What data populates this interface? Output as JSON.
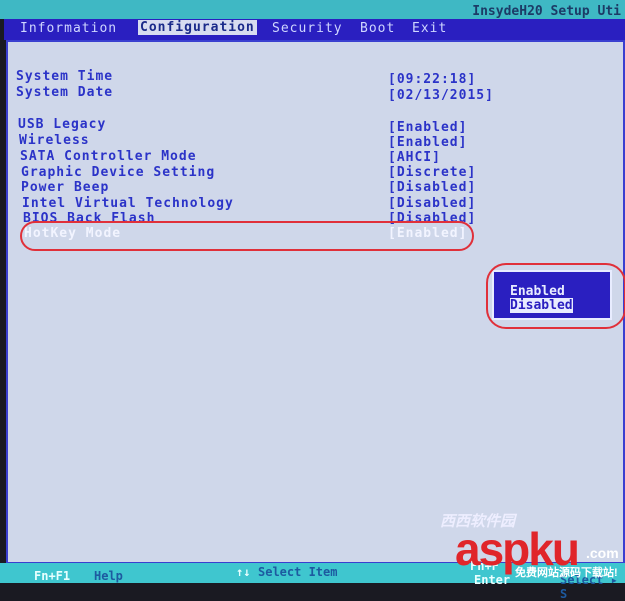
{
  "header": {
    "vendor": "InsydeH20 Setup Uti"
  },
  "tabs": [
    {
      "label": "Information"
    },
    {
      "label": "Configuration",
      "active": true
    },
    {
      "label": "Security"
    },
    {
      "label": "Boot"
    },
    {
      "label": "Exit"
    }
  ],
  "items": [
    {
      "label": "System Time",
      "value": "[09:22:18]"
    },
    {
      "label": "System Date",
      "value": "[02/13/2015]"
    },
    {
      "label": "USB Legacy",
      "value": "[Enabled]"
    },
    {
      "label": "Wireless",
      "value": "[Enabled]"
    },
    {
      "label": "SATA Controller Mode",
      "value": "[AHCI]"
    },
    {
      "label": "Graphic Device Setting",
      "value": "[Discrete]"
    },
    {
      "label": "Power Beep",
      "value": "[Disabled]"
    },
    {
      "label": "Intel Virtual Technology",
      "value": "[Disabled]"
    },
    {
      "label": "BIOS Back Flash",
      "value": "[Disabled]"
    },
    {
      "label": "HotKey Mode",
      "value": "[Enabled]",
      "selected": true
    }
  ],
  "popup": {
    "options": [
      "Enabled",
      "Disabled"
    ],
    "highlighted": "Disabled"
  },
  "footer": {
    "k1": "Fn+F1",
    "d1": "Help",
    "k2": "↑↓",
    "d2": "Select Item",
    "k3": "Fn+F",
    "k4": "Enter",
    "d4": "Select ▸ S"
  },
  "watermark": {
    "site": "aspku",
    "tld": ".com",
    "slogan": "免费网站源码下载站!",
    "brand": "西西软件园"
  },
  "colors": {
    "menu": "#2a1fc0",
    "panel": "#cfd7ea",
    "highlight": "#e0303a"
  }
}
